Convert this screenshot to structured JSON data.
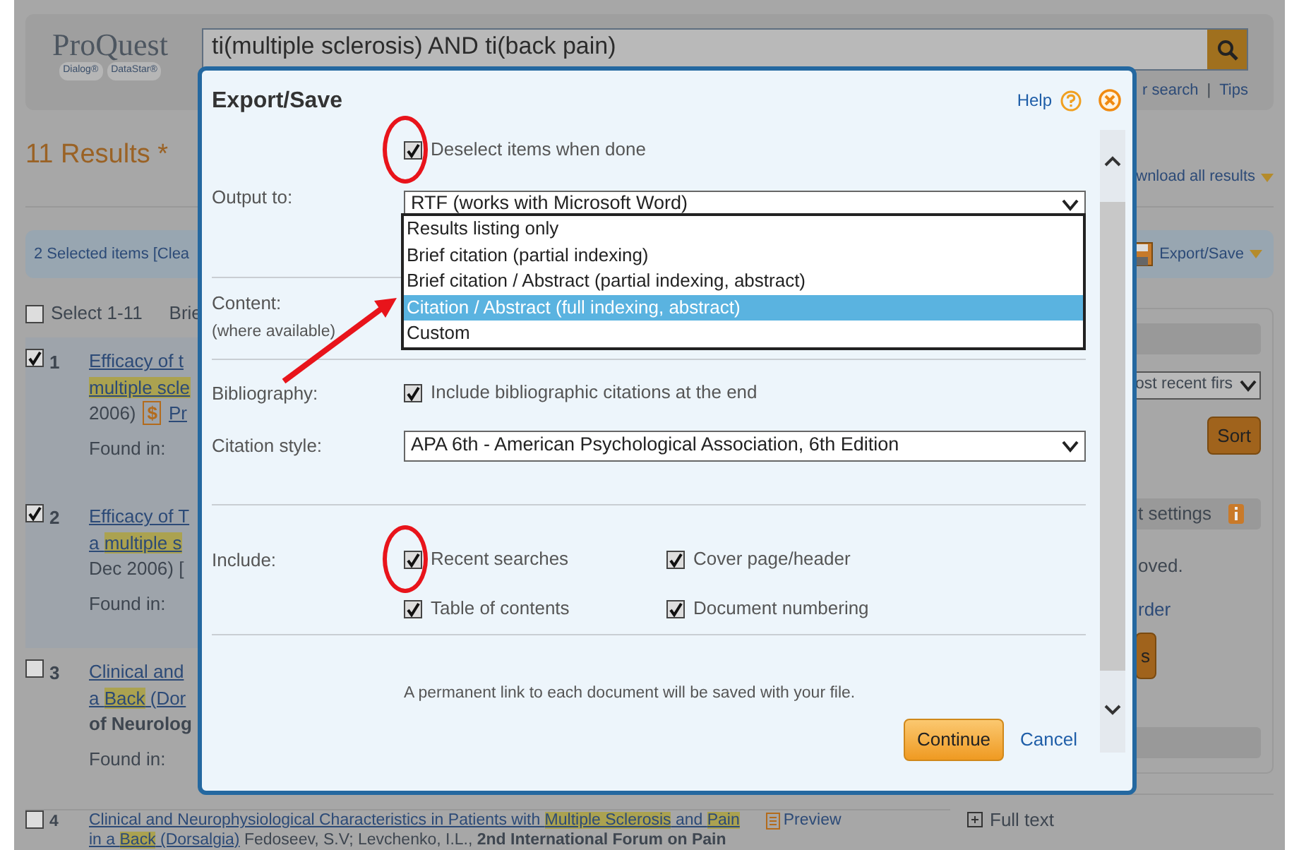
{
  "header": {
    "logo": {
      "name": "ProQuest",
      "left_tag": "Dialog®",
      "right_tag": "DataStar®"
    },
    "search": {
      "value": "ti(multiple sclerosis) AND ti(back pain)"
    },
    "links": [
      "r search",
      "Tips"
    ],
    "separator": "|"
  },
  "results_heading": "11 Results *",
  "download_link": "wnload all results",
  "selection_bar": {
    "text": "2 Selected items [Clea",
    "export": "Export/Save"
  },
  "select_all": {
    "label": "Select 1-11",
    "checked": false,
    "view": "Brie"
  },
  "results": [
    {
      "number": "1",
      "checked": true,
      "lines": [
        [
          {
            "text": "Efficacy of t",
            "kind": "link",
            "highlight": false
          }
        ],
        [
          {
            "text": "multiple scle",
            "kind": "link",
            "highlight": true
          }
        ],
        [
          {
            "text": "2006)",
            "kind": "text",
            "highlight": false
          },
          {
            "text": "$",
            "kind": "price",
            "highlight": false
          },
          {
            "text": "Pr",
            "kind": "link",
            "highlight": false
          }
        ]
      ],
      "found_in": "Found in:"
    },
    {
      "number": "2",
      "checked": true,
      "lines": [
        [
          {
            "text": "Efficacy of T",
            "kind": "link",
            "highlight": false
          }
        ],
        [
          {
            "text": "a ",
            "kind": "link",
            "highlight": false
          },
          {
            "text": "multiple s",
            "kind": "link",
            "highlight": true
          }
        ],
        [
          {
            "text": "Dec 2006) [",
            "kind": "text",
            "highlight": false
          }
        ]
      ],
      "found_in": "Found in:"
    },
    {
      "number": "3",
      "checked": false,
      "lines": [
        [
          {
            "text": "Clinical and",
            "kind": "link",
            "highlight": false
          }
        ],
        [
          {
            "text": "a ",
            "kind": "link",
            "highlight": false
          },
          {
            "text": "Back",
            "kind": "link",
            "highlight": true
          },
          {
            "text": " (Dor",
            "kind": "link",
            "highlight": false
          }
        ],
        [
          {
            "text": "of Neurolog",
            "kind": "bold",
            "highlight": false
          }
        ]
      ],
      "found_in": "Found in:"
    },
    {
      "number": "4",
      "checked": false,
      "preview": "Preview",
      "lines": [
        [
          {
            "text": "Clinical and Neurophysiological Characteristics in Patients with ",
            "kind": "link",
            "highlight": false
          },
          {
            "text": "Multiple Sclerosis",
            "kind": "link",
            "highlight": true
          },
          {
            "text": " and ",
            "kind": "link",
            "highlight": false
          },
          {
            "text": "Pain",
            "kind": "link",
            "highlight": true
          }
        ],
        [
          {
            "text": "in a ",
            "kind": "link",
            "highlight": false
          },
          {
            "text": "Back",
            "kind": "link",
            "highlight": true
          },
          {
            "text": " (Dorsalgia)",
            "kind": "link",
            "highlight": false
          },
          {
            "text": " Fedoseev, S.V; Levchenko, I.L., ",
            "kind": "text",
            "highlight": false
          },
          {
            "text": "2nd International Forum on Pain",
            "kind": "bold",
            "highlight": false
          }
        ]
      ]
    }
  ],
  "sidebar": {
    "sort_select": "ost recent firs",
    "sort_button": "Sort",
    "settings_title": "t settings",
    "settings_text": "oved.",
    "settings_link": "rder",
    "settings_button": "s",
    "full_text": "Full text"
  },
  "dialog": {
    "title": "Export/Save",
    "help": "Help",
    "deselect": {
      "label": "Deselect items when done",
      "checked": true,
      "circled": true
    },
    "output": {
      "label": "Output to:",
      "value": "RTF (works with Microsoft Word)",
      "expanded": true
    },
    "content": {
      "label": "Content:",
      "note": "(where available)",
      "options": [
        {
          "label": "Results listing only",
          "selected": false,
          "arrow": false
        },
        {
          "label": "Brief citation (partial indexing)",
          "selected": false,
          "arrow": false
        },
        {
          "label": "Brief citation / Abstract (partial indexing, abstract)",
          "selected": false,
          "arrow": false
        },
        {
          "label": "Citation / Abstract (full indexing, abstract)",
          "selected": true,
          "arrow": true
        },
        {
          "label": "Custom",
          "selected": false,
          "arrow": false
        }
      ]
    },
    "bibliography": {
      "label": "Bibliography:",
      "checkbox": {
        "label": "Include bibliographic citations at the end",
        "checked": true,
        "circled": false
      }
    },
    "citation": {
      "label": "Citation style:",
      "value": "APA 6th - American Psychological Association, 6th Edition"
    },
    "include": {
      "label": "Include:",
      "items": [
        {
          "label": "Recent searches",
          "checked": true,
          "circled": true
        },
        {
          "label": "Cover page/header",
          "checked": true,
          "circled": false
        },
        {
          "label": "Table of contents",
          "checked": true,
          "circled": false
        },
        {
          "label": "Document numbering",
          "checked": true,
          "circled": false
        }
      ]
    },
    "note": "A permanent link to each document will be saved with your file.",
    "continue": "Continue",
    "cancel": "Cancel"
  }
}
